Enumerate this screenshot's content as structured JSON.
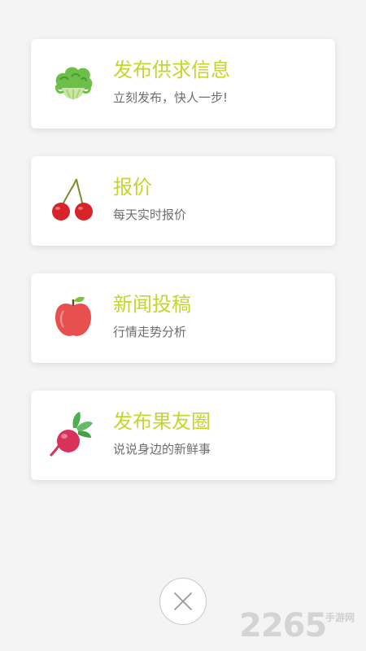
{
  "menu": {
    "items": [
      {
        "title": "发布供求信息",
        "subtitle": "立刻发布，快人一步!",
        "icon": "lettuce-icon"
      },
      {
        "title": "报价",
        "subtitle": "每天实时报价",
        "icon": "cherry-icon"
      },
      {
        "title": "新闻投稿",
        "subtitle": "行情走势分析",
        "icon": "apple-icon"
      },
      {
        "title": "发布果友圈",
        "subtitle": "说说身边的新鲜事",
        "icon": "radish-icon"
      }
    ]
  },
  "close_button": {
    "icon": "close-icon"
  },
  "watermark": {
    "number": "2265",
    "text": "手游网"
  },
  "colors": {
    "title": "#c5d52e",
    "subtitle": "#6e6e6e",
    "background": "#f4f4f4",
    "card": "#ffffff"
  }
}
